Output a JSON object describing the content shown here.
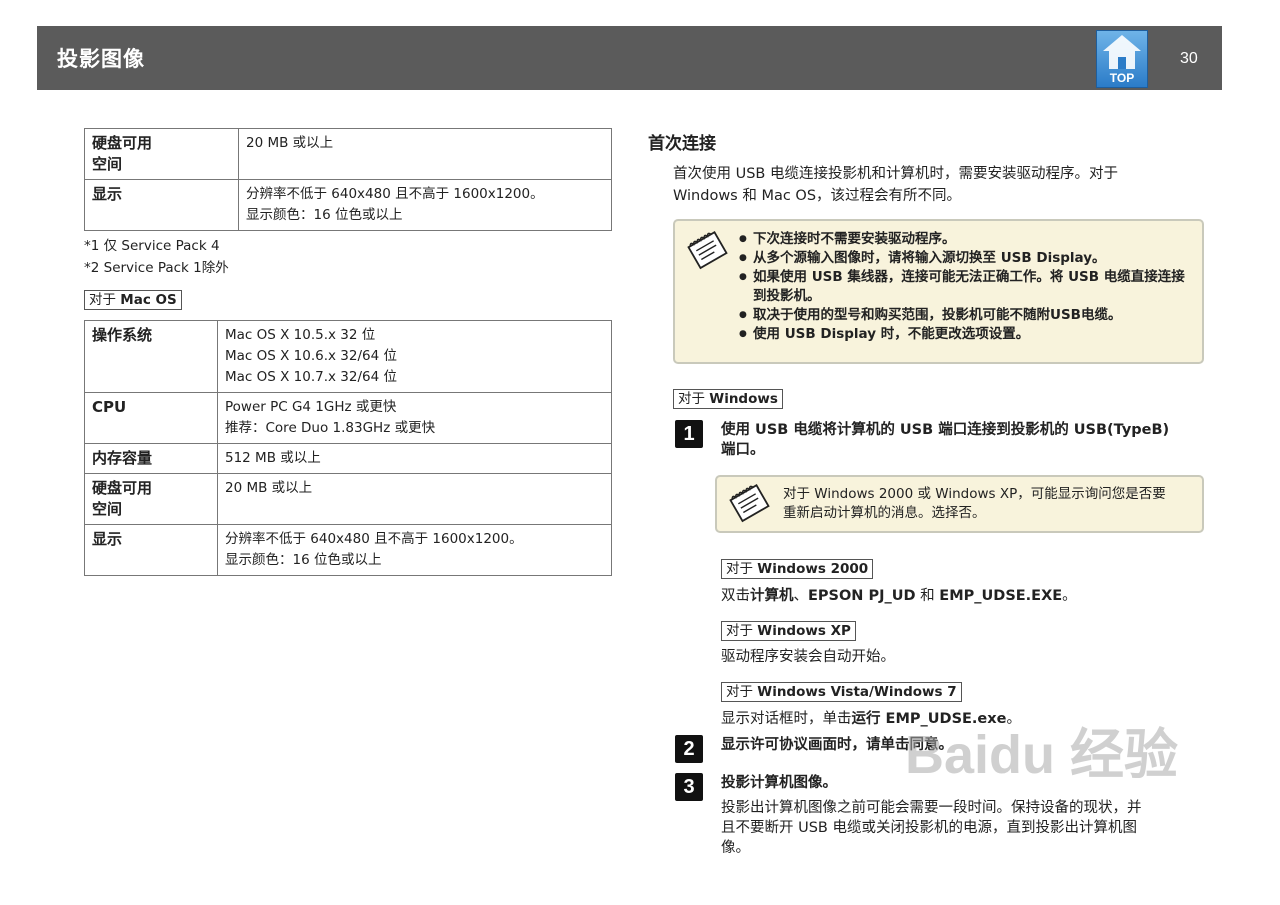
{
  "header": {
    "title": "投影图像",
    "top_label": "TOP",
    "page_number": "30"
  },
  "table1": {
    "rows": [
      {
        "key": "硬盘可用\n空间",
        "value": "20  MB  或以上"
      },
      {
        "key": "显示",
        "value": "分辨率不低于  640x480  且不高于  1600x1200。\n显示颜色：16  位色或以上"
      }
    ]
  },
  "notes": {
    "n1": "*1  仅  Service  Pack  4",
    "n2": "*2  Service  Pack  1除外"
  },
  "mac_tag": {
    "prefix": "对于",
    "name": "Mac  OS"
  },
  "table2": {
    "rows": [
      {
        "key": "操作系统",
        "value": "Mac OS X 10.5.x 32 位\nMac OS X 10.6.x 32/64 位\nMac OS X 10.7.x 32/64 位"
      },
      {
        "key": "CPU",
        "value": "Power PC G4 1GHz 或更快\n推荐：Core Duo 1.83GHz 或更快"
      },
      {
        "key": "内存容量",
        "value": "512 MB 或以上"
      },
      {
        "key": "硬盘可用\n空间",
        "value": "20 MB 或以上"
      },
      {
        "key": "显示",
        "value": "分辨率不低于 640x480 且不高于 1600x1200。\n显示颜色：16 位色或以上"
      }
    ]
  },
  "right": {
    "section_title": "首次连接",
    "intro": "首次使用  USB  电缆连接投影机和计算机时，需要安装驱动程序。对于\nWindows  和  Mac  OS，该过程会有所不同。",
    "notebox1": [
      "下次连接时不需要安装驱动程序。",
      "从多个源输入图像时，请将输入源切换至  USB  Display。",
      "如果使用  USB  集线器，连接可能无法正确工作。将  USB  电缆直接连接到投影机。",
      "取决于使用的型号和购买范围，投影机可能不随附USB电缆。",
      "使用  USB  Display  时，不能更改选项设置。"
    ],
    "windows_tag": {
      "prefix": "对于",
      "name": "Windows"
    },
    "step1": {
      "num": "1",
      "text": "使用  USB  电缆将计算机的  USB  端口连接到投影机的  USB(TypeB)\n端口。",
      "note": "对于  Windows  2000  或  Windows  XP，可能显示询问您是否要\n重新启动计算机的消息。选择否。"
    },
    "win2000_tag": {
      "prefix": "对于",
      "name": "Windows  2000"
    },
    "win2000_text": {
      "pre": "双击",
      "a": "计算机",
      "sep": "、",
      "b": "EPSON  PJ_UD",
      "mid": "  和  ",
      "c": "EMP_UDSE.EXE",
      "end": "。"
    },
    "winxp_tag": {
      "prefix": "对于",
      "name": "Windows  XP"
    },
    "winxp_text": "驱动程序安装会自动开始。",
    "win7_tag": {
      "prefix": "对于",
      "name": "Windows  Vista/Windows  7"
    },
    "win7_text": {
      "pre": "显示对话框时，单击",
      "a": "运行",
      "b": "  EMP_UDSE.exe",
      "end": "。"
    },
    "step2": {
      "num": "2",
      "text": "显示许可协议画面时，请单击同意。"
    },
    "step3": {
      "num": "3",
      "text": "投影计算机图像。",
      "detail": "投影出计算机图像之前可能会需要一段时间。保持设备的现状，并\n且不要断开  USB  电缆或关闭投影机的电源，直到投影出计算机图\n像。"
    }
  },
  "watermark": "Baidu 经验"
}
